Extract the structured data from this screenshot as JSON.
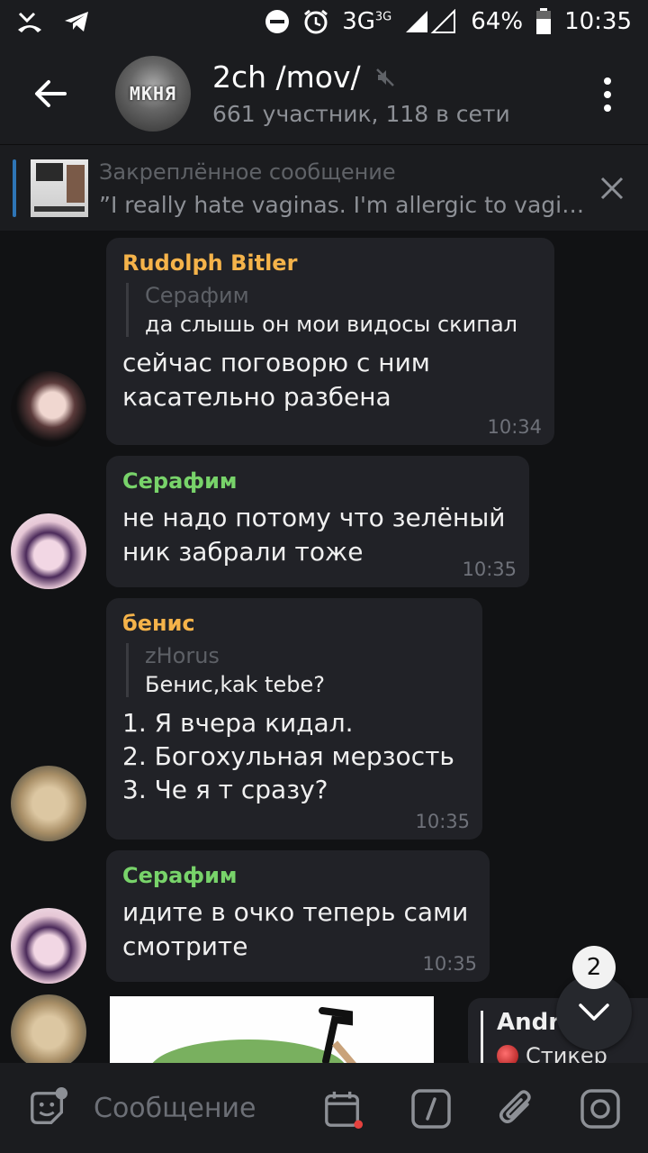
{
  "status_bar": {
    "network": "3G",
    "network_sup": "3G",
    "battery": "64%",
    "time": "10:35",
    "icons": [
      "missed-call-icon",
      "telegram-icon",
      "dnd-icon",
      "alarm-icon",
      "signal-icon",
      "battery-icon"
    ]
  },
  "header": {
    "title": "2ch /mov/",
    "avatar_text": "MKHЯ",
    "subtitle": "661 участник, 118 в сети"
  },
  "pinned": {
    "label": "Закреплённое сообщение",
    "text": "”I really hate vaginas. I'm allergic to vaginas."
  },
  "messages": [
    {
      "sender": "Rudolph Bitler",
      "sender_color": "#f5b34a",
      "reply_to": "Серафим",
      "reply_text": "да слышь он мои видосы скипал",
      "lines": [
        "сейчас поговорю с ним",
        "касательно разбена"
      ],
      "time": "10:34"
    },
    {
      "sender": "Серафим",
      "sender_color": "#78d36a",
      "lines": [
        "не надо потому что зелёный",
        "ник забрали тоже"
      ],
      "time": "10:35"
    },
    {
      "sender": "бенис",
      "sender_color": "#f5b34a",
      "reply_to": "zHorus",
      "reply_text": "Бенис,kak tebe?",
      "lines": [
        "1. Я вчера кидал.",
        "2. Богохульная мерзость",
        "3. Че я т сразу?"
      ],
      "time": "10:35"
    },
    {
      "sender": "Серафим",
      "sender_color": "#78d36a",
      "lines": [
        "идите в очко теперь сами",
        "смотрите"
      ],
      "time": "10:35"
    }
  ],
  "sticker_reply": {
    "name": "Andre",
    "text": "Стикер"
  },
  "unread_count": "2",
  "input": {
    "placeholder": "Сообщение"
  }
}
